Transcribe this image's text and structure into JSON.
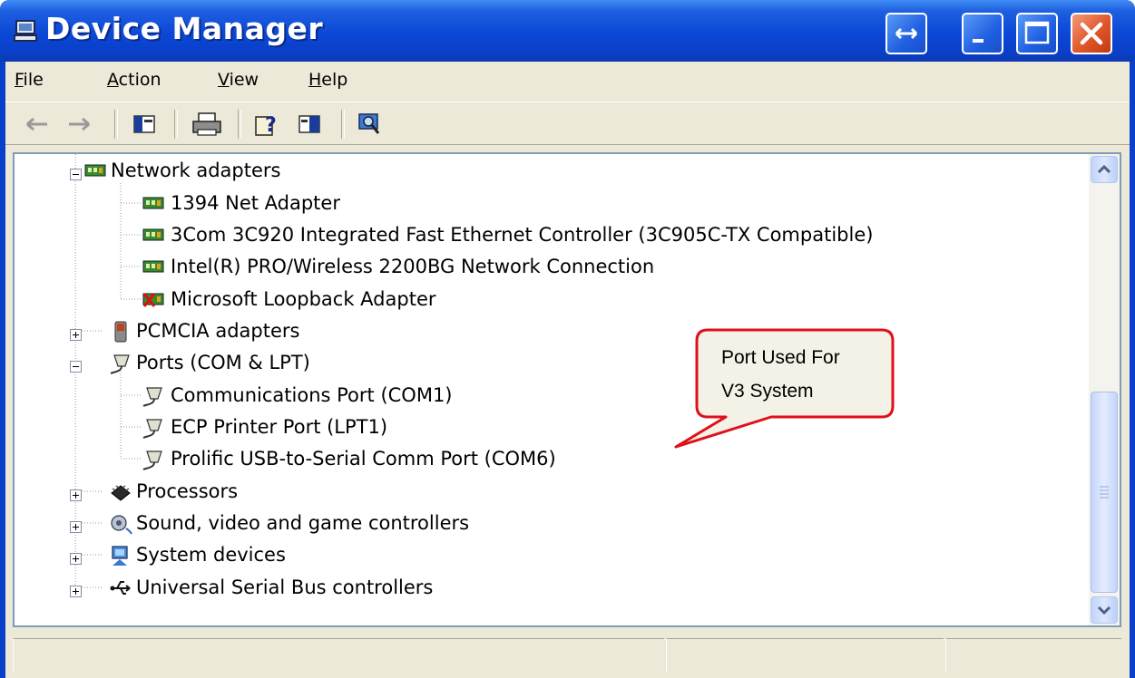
{
  "window": {
    "title": "Device Manager"
  },
  "titlebar_buttons": {
    "resize": "resize-icon",
    "minimize": "minimize-icon",
    "maximize": "maximize-icon",
    "close": "close-icon"
  },
  "menu": [
    {
      "label": "File",
      "accel": "F",
      "rest": "ile"
    },
    {
      "label": "Action",
      "accel": "A",
      "rest": "ction"
    },
    {
      "label": "View",
      "accel": "V",
      "rest": "iew"
    },
    {
      "label": "Help",
      "accel": "H",
      "rest": "elp"
    }
  ],
  "toolbar": [
    "back-icon",
    "forward-icon",
    "show-hide-tree-icon",
    "print-icon",
    "help-icon",
    "properties-icon",
    "scan-hardware-icon"
  ],
  "tree": {
    "network_adapters": {
      "label": "Network adapters",
      "items": [
        "1394 Net Adapter",
        "3Com 3C920 Integrated Fast Ethernet Controller (3C905C-TX Compatible)",
        "Intel(R) PRO/Wireless 2200BG Network Connection",
        "Microsoft Loopback Adapter"
      ]
    },
    "pcmcia": {
      "label": "PCMCIA adapters"
    },
    "ports": {
      "label": "Ports (COM & LPT)",
      "items": [
        "Communications Port (COM1)",
        "ECP Printer Port (LPT1)",
        "Prolific USB-to-Serial Comm Port (COM6)"
      ]
    },
    "processors": {
      "label": "Processors"
    },
    "sound": {
      "label": "Sound, video and game controllers"
    },
    "system": {
      "label": "System devices"
    },
    "usb": {
      "label": "Universal Serial Bus controllers"
    }
  },
  "callout": {
    "line1": "Port Used For",
    "line2": "V3 System"
  },
  "colors": {
    "titlebar": "#0a3fc9",
    "callout_border": "#e0101a",
    "callout_fill": "#f4f1e6"
  }
}
